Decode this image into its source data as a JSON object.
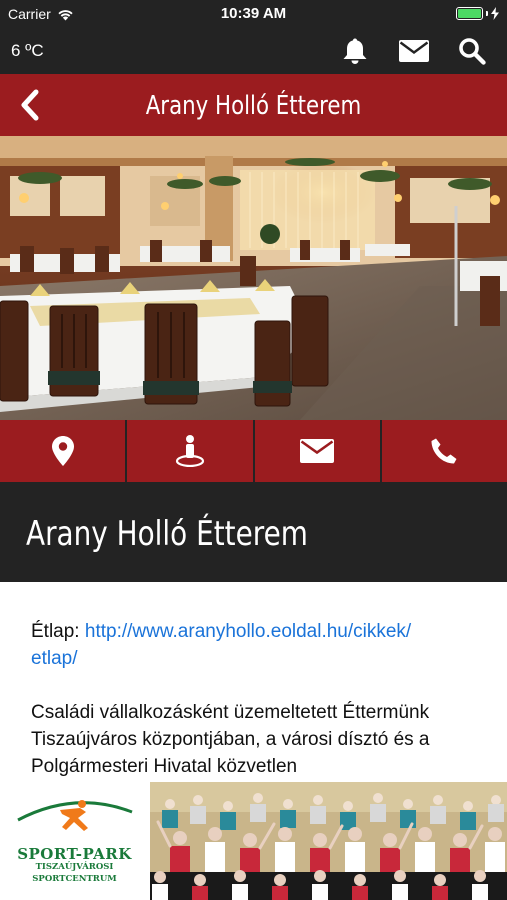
{
  "status_bar": {
    "carrier": "Carrier",
    "time": "10:39 AM"
  },
  "toolbar": {
    "temperature": "6 ºC",
    "icons": [
      "bell-icon",
      "envelope-icon",
      "search-icon"
    ]
  },
  "header": {
    "title": "Arany Holló Étterem",
    "back_icon": "chevron-left-icon"
  },
  "hero_image": {
    "description_icon": "restaurant-photo"
  },
  "actions": [
    {
      "icon": "map-pin-icon"
    },
    {
      "icon": "person-on-map-icon"
    },
    {
      "icon": "envelope-icon"
    },
    {
      "icon": "phone-icon"
    }
  ],
  "venue": {
    "name": "Arany Holló Étterem"
  },
  "content": {
    "menu_label": "Étlap: ",
    "menu_link": "http://www.aranyhollo.eoldal.hu/cikkek/etlap/",
    "menu_link_line1": "http://www.aranyhollo.eoldal.hu/cikkek/",
    "menu_link_line2": "etlap/",
    "description_line1": "Családi vállalkozásként üzemeltetett Éttermünk",
    "description_line2": "Tiszaújváros központjában, a városi dísztó és a",
    "description_line3": "Polgármesteri Hivatal közvetlen"
  },
  "ad_banner": {
    "brand": "SPORT-PARK",
    "subtitle1": "TISZAÚJVÁROSI",
    "subtitle2": "SPORTCENTRUM"
  },
  "colors": {
    "brand_red": "#9b1c1f",
    "dark_bar": "#232323",
    "link_blue": "#1a73d9",
    "logo_green": "#1a7a3a",
    "battery_green": "#4cd964"
  }
}
